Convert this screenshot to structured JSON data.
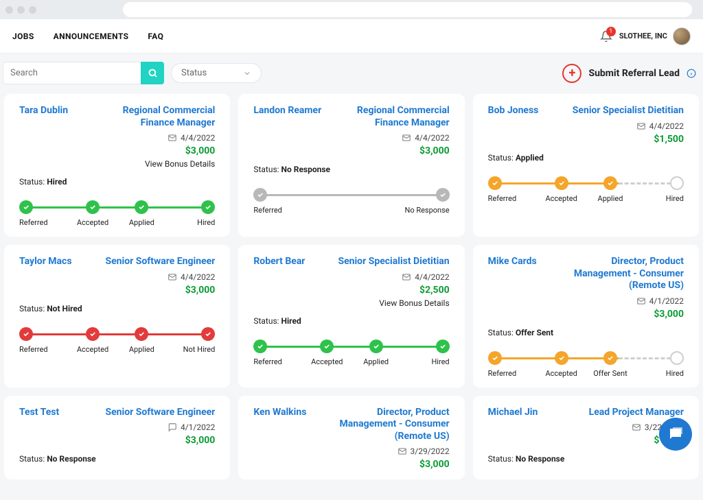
{
  "nav": {
    "jobs": "JOBS",
    "announcements": "ANNOUNCEMENTS",
    "faq": "FAQ"
  },
  "header": {
    "notif_count": "1",
    "company": "SLOTHEE, INC"
  },
  "filters": {
    "search_placeholder": "Search",
    "status_label": "Status",
    "submit_label": "Submit Referral Lead"
  },
  "labels": {
    "status_prefix": "Status: "
  },
  "cards": [
    {
      "name": "Tara Dublin",
      "job": "Regional Commercial Finance Manager",
      "date": "4/4/2022",
      "bonus": "$3,000",
      "detail": "View Bonus Details",
      "status": "Hired",
      "color": "green",
      "steps": [
        "Referred",
        "Accepted",
        "Applied",
        "Hired"
      ],
      "done": 4
    },
    {
      "name": "Landon Reamer",
      "job": "Regional Commercial Finance Manager",
      "date": "4/4/2022",
      "bonus": "$3,000",
      "detail": "",
      "status": "No Response",
      "color": "gray",
      "steps": [
        "Referred",
        "No Response"
      ],
      "done": 2
    },
    {
      "name": "Bob Joness",
      "job": "Senior Specialist Dietitian",
      "date": "4/4/2022",
      "bonus": "$1,500",
      "detail": "",
      "status": "Applied",
      "color": "orange",
      "steps": [
        "Referred",
        "Accepted",
        "Applied",
        "Hired"
      ],
      "done": 3
    },
    {
      "name": "Taylor Macs",
      "job": "Senior Software Engineer",
      "date": "4/4/2022",
      "bonus": "$3,000",
      "detail": "",
      "status": "Not Hired",
      "color": "red",
      "steps": [
        "Referred",
        "Accepted",
        "Applied",
        "Not Hired"
      ],
      "done": 4
    },
    {
      "name": "Robert Bear",
      "job": "Senior Specialist Dietitian",
      "date": "4/4/2022",
      "bonus": "$2,500",
      "detail": "View Bonus Details",
      "status": "Hired",
      "color": "green",
      "steps": [
        "Referred",
        "Accepted",
        "Applied",
        "Hired"
      ],
      "done": 4
    },
    {
      "name": "Mike Cards",
      "job": "Director, Product Management - Consumer (Remote US)",
      "date": "4/1/2022",
      "bonus": "$3,000",
      "detail": "",
      "status": "Offer Sent",
      "color": "orange",
      "steps": [
        "Referred",
        "Accepted",
        "Offer Sent",
        "Hired"
      ],
      "done": 3
    },
    {
      "name": "Test Test",
      "job": "Senior Software Engineer",
      "date": "4/1/2022",
      "bonus": "$3,000",
      "detail": "",
      "status": "No Response",
      "color": "gray",
      "steps": [],
      "done": 0,
      "msg_icon": true
    },
    {
      "name": "Ken Walkins",
      "job": "Director, Product Management - Consumer (Remote US)",
      "date": "3/29/2022",
      "bonus": "$3,000",
      "detail": "",
      "status": "",
      "color": "gray",
      "steps": [],
      "done": 0
    },
    {
      "name": "Michael Jin",
      "job": "Lead Project Manager",
      "date": "3/22/2022",
      "bonus": "$1,500",
      "detail": "",
      "status": "No Response",
      "color": "gray",
      "steps": [],
      "done": 0
    }
  ]
}
